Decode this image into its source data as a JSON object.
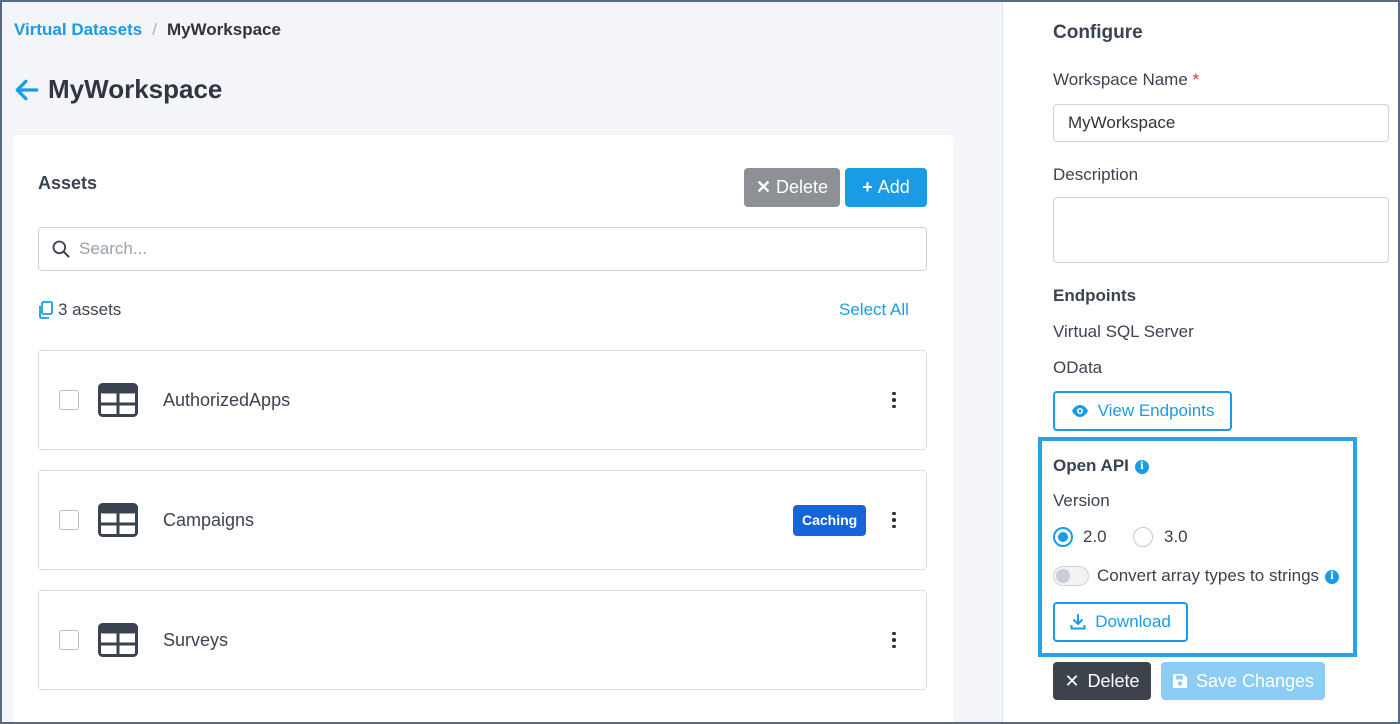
{
  "breadcrumb": {
    "parent": "Virtual Datasets",
    "separator": "/",
    "current": "MyWorkspace"
  },
  "page": {
    "title": "MyWorkspace"
  },
  "assets": {
    "title": "Assets",
    "delete_label": "Delete",
    "add_label": "Add",
    "search_placeholder": "Search...",
    "count_label": "3 assets",
    "select_all_label": "Select All",
    "items": [
      {
        "name": "AuthorizedApps",
        "badge": ""
      },
      {
        "name": "Campaigns",
        "badge": "Caching"
      },
      {
        "name": "Surveys",
        "badge": ""
      }
    ]
  },
  "configure": {
    "title": "Configure",
    "workspace_name_label": "Workspace Name",
    "required_mark": "*",
    "workspace_name_value": "MyWorkspace",
    "description_label": "Description",
    "description_value": "",
    "endpoints_label": "Endpoints",
    "endpoint_items": [
      "Virtual SQL Server",
      "OData"
    ],
    "view_endpoints_label": "View Endpoints",
    "open_api": {
      "title": "Open API",
      "version_label": "Version",
      "versions": [
        "2.0",
        "3.0"
      ],
      "selected_version": "2.0",
      "convert_label": "Convert array types to strings",
      "convert_enabled": false,
      "download_label": "Download"
    },
    "delete_label": "Delete",
    "save_label": "Save Changes"
  },
  "colors": {
    "accent": "#1a9be6",
    "caching_badge": "#1565d8",
    "highlight_border": "#27a3ea",
    "required": "#d9323a"
  },
  "icons": [
    "arrow-left-icon",
    "search-icon",
    "copy-icon",
    "table-icon",
    "kebab-icon",
    "close-icon",
    "plus-icon",
    "eye-icon",
    "info-icon",
    "download-icon",
    "save-icon"
  ]
}
